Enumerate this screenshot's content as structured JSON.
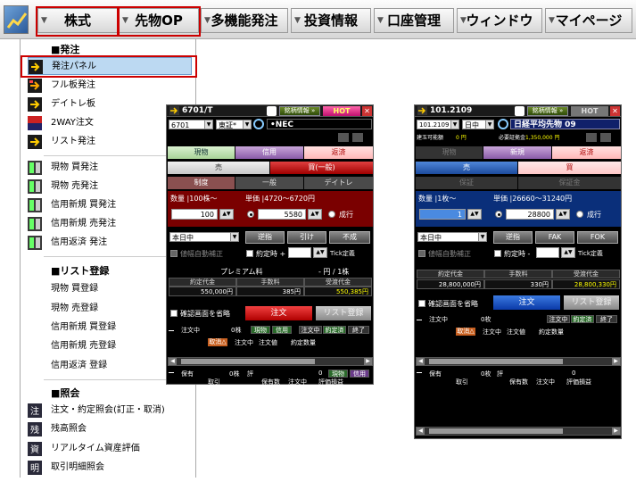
{
  "menubar": {
    "items": [
      {
        "label": "株式"
      },
      {
        "label": "先物OP"
      },
      {
        "label": "多機能発注"
      },
      {
        "label": "投資情報"
      },
      {
        "label": "口座管理"
      },
      {
        "label": "ウィンドウ"
      },
      {
        "label": "マイページ"
      }
    ],
    "arrow": "▼"
  },
  "dropdown": {
    "sections": [
      {
        "heading": "■発注",
        "items": [
          {
            "label": "発注パネル",
            "icon": "order-panel-icon"
          },
          {
            "label": "フル板発注",
            "icon": "full-board-icon"
          },
          {
            "label": "デイトレ板",
            "icon": "daytrade-board-icon"
          },
          {
            "label": "2WAY注文",
            "icon": "two-way-icon"
          },
          {
            "label": "リスト発注",
            "icon": "list-order-icon"
          }
        ]
      },
      {
        "items": [
          {
            "label": "現物 買発注",
            "icon": "board-icon"
          },
          {
            "label": "現物 売発注",
            "icon": "board-icon"
          },
          {
            "label": "信用新規 買発注",
            "icon": "board-icon"
          },
          {
            "label": "信用新規 売発注",
            "icon": "board-icon"
          },
          {
            "label": "信用返済 発注",
            "icon": "board-icon"
          }
        ]
      },
      {
        "heading": "■リスト登録",
        "items": [
          {
            "label": "現物 買登録"
          },
          {
            "label": "現物 売登録"
          },
          {
            "label": "信用新規 買登録"
          },
          {
            "label": "信用新規 売登録"
          },
          {
            "label": "信用返済 登録"
          }
        ]
      },
      {
        "heading": "■照会",
        "items": [
          {
            "label": "注文・約定照会(訂正・取消)",
            "icon": "inquiry-icon"
          },
          {
            "label": "残高照会",
            "icon": "balance-icon"
          },
          {
            "label": "リアルタイム資産評価",
            "icon": "asset-icon"
          },
          {
            "label": "取引明細照会",
            "icon": "detail-icon"
          }
        ]
      }
    ]
  },
  "panel1": {
    "title": "6701/T",
    "info_btn": "銘柄情報 »",
    "hot": "HOT",
    "close": "✕",
    "code": "6701",
    "market": "東証*",
    "name": "•NEC",
    "tabs": [
      "現物",
      "信用",
      "返済"
    ],
    "sides": [
      "売",
      "買(一般)"
    ],
    "subtabs": [
      "制度",
      "一般",
      "デイトレ"
    ],
    "qty_label": "数量 |100株〜",
    "price_label": "単価 |4720〜6720円",
    "qty": "100",
    "price": "5580",
    "market_order": "成行",
    "expire": "本日中",
    "btns": [
      "逆指",
      "引け",
      "不成"
    ],
    "auto_fix": "値幅自動補正",
    "trail": "約定時 +",
    "tick": "Tick定義",
    "premium": "プレミアム料",
    "premium_val": "- 円 / 1株",
    "cols": [
      "約定代金",
      "手数料",
      "受渡代金"
    ],
    "vals": [
      "550,000",
      "385",
      "550,385"
    ],
    "unit": "円",
    "confirm": "確認画面を省略",
    "order": "注文",
    "list_reg": "リスト登録",
    "ord_row": {
      "label": "注文中",
      "count": "0株",
      "tags": [
        "現物",
        "信用",
        "注文中",
        "約定済",
        "終了"
      ]
    },
    "ord_head": [
      "取消",
      "注文中",
      "注文値",
      "約定数量"
    ],
    "cancel_mark": "△",
    "hold_row": {
      "label": "保有",
      "count": "0株",
      "eval": "評",
      "n": "0",
      "tags": [
        "現物",
        "信用"
      ]
    },
    "hold_head": [
      "取引",
      "保有数",
      "注文中",
      "評価損益"
    ]
  },
  "panel2": {
    "title": "101.2109",
    "info_btn": "銘柄情報 »",
    "hot": "HOT",
    "close": "✕",
    "code": "101.2109",
    "session": "日中",
    "name": "日経平均先物 09",
    "power_label": "建玉可能額",
    "power_val": "0 円",
    "margin_label": "必要証拠金",
    "margin_val": "1,350,000 円",
    "tabs": [
      "現物",
      "新規",
      "返済"
    ],
    "sides": [
      "売",
      "買"
    ],
    "subtabs": [
      "保証",
      "保証金"
    ],
    "qty_label": "数量 |1枚〜",
    "price_label": "単価 |26660〜31240円",
    "qty": "1",
    "price": "28800",
    "market_order": "成行",
    "expire": "本日中",
    "btns": [
      "逆指",
      "FAK",
      "FOK"
    ],
    "auto_fix": "値幅自動補正",
    "trail": "約定時 -",
    "tick": "Tick定義",
    "cols": [
      "約定代金",
      "手数料",
      "受渡代金"
    ],
    "vals": [
      "28,800,000",
      "330",
      "28,800,330"
    ],
    "unit": "円",
    "confirm": "確認画面を省略",
    "order": "注文",
    "list_reg": "リスト登録",
    "ord_row": {
      "label": "注文中",
      "count": "0枚",
      "tags": [
        "注文中",
        "約定済",
        "終了"
      ]
    },
    "ord_head": [
      "取消",
      "注文中",
      "注文値",
      "約定数量"
    ],
    "cancel_mark": "△",
    "hold_row": {
      "label": "保有",
      "count": "0枚",
      "eval": "評",
      "n": "0"
    },
    "hold_head": [
      "取引",
      "保有数",
      "注文中",
      "評価損益"
    ]
  }
}
